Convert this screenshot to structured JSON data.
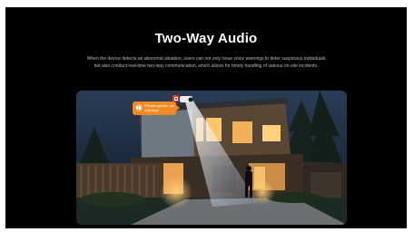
{
  "section": {
    "title": "Two-Way Audio",
    "description": "When the device detects an abnormal situation, users can not only issue voice warnings to deter suspicious individuals but also conduct real-time two-way communication, which allows for timely handling of various on-site incidents."
  },
  "scene": {
    "voice_bubble_text": "Private garden, no entering!",
    "speaker_icon": "speaker-icon",
    "alarm_icon": "alarm-badge-icon"
  }
}
